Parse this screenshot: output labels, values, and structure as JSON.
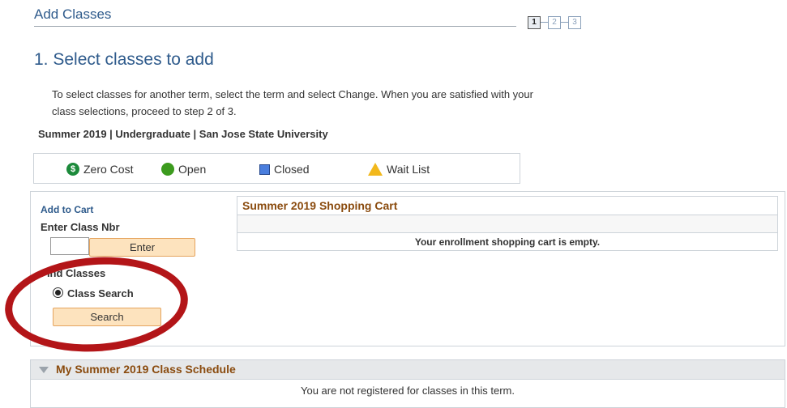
{
  "header": {
    "title": "Add Classes",
    "steps": [
      "1",
      "2",
      "3"
    ]
  },
  "page": {
    "heading": "1.  Select classes to add",
    "instructions": "To select classes for another term, select the term and select Change.  When you are satisfied with your class selections, proceed to step 2 of 3.",
    "term_line": "Summer 2019 | Undergraduate | San Jose State University"
  },
  "legend": {
    "zero_cost": "Zero Cost",
    "open": "Open",
    "closed": "Closed",
    "wait_list": "Wait List"
  },
  "add_to_cart": {
    "title": "Add to Cart",
    "enter_nbr_label": "Enter Class Nbr",
    "class_nbr_value": "",
    "enter_button": "Enter",
    "find_classes_label": "Find Classes",
    "class_search_label": "Class Search",
    "search_button": "Search"
  },
  "cart": {
    "title": "Summer 2019 Shopping Cart",
    "empty_message": "Your enrollment shopping cart is empty."
  },
  "schedule": {
    "title": "My Summer 2019 Class Schedule",
    "message": "You are not registered for classes in this term."
  },
  "colors": {
    "heading_blue": "#2f5b8c",
    "section_title_brown": "#8a4b0e",
    "button_bg": "#fde3be",
    "annotation_red": "#b31518"
  }
}
